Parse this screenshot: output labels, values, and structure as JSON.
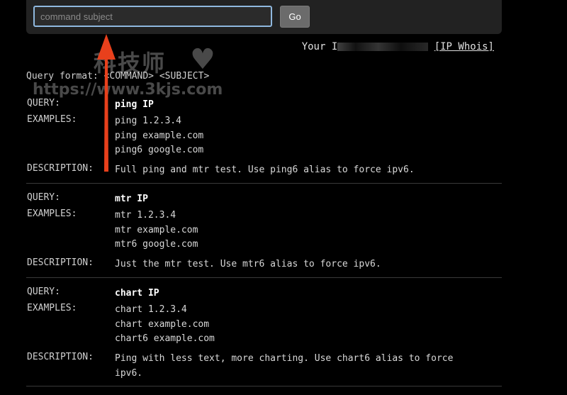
{
  "search": {
    "placeholder": "command subject",
    "go_label": "Go"
  },
  "header": {
    "ip_prefix": "Your I",
    "ip_suffix": "[IP Whois]"
  },
  "query_format": "Query format: <COMMAND> <SUBJECT>",
  "watermark": {
    "chinese": "科技师",
    "url": "https://www.3kjs.com"
  },
  "labels": {
    "query": "QUERY:",
    "examples": "EXAMPLES:",
    "description": "DESCRIPTION:"
  },
  "commands": [
    {
      "query": "ping IP",
      "examples": [
        "ping 1.2.3.4",
        "ping example.com",
        "ping6 google.com"
      ],
      "description": "Full ping and mtr test. Use ping6 alias to force ipv6."
    },
    {
      "query": "mtr IP",
      "examples": [
        "mtr 1.2.3.4",
        "mtr example.com",
        "mtr6 google.com"
      ],
      "description": "Just the mtr test. Use mtr6 alias to force ipv6."
    },
    {
      "query": "chart IP",
      "examples": [
        "chart 1.2.3.4",
        "chart example.com",
        "chart6 example.com"
      ],
      "description": "Ping with less text, more charting. Use chart6 alias to force ipv6."
    }
  ],
  "colors": {
    "background": "#000000",
    "topbar": "#222222",
    "input_border": "#8fb8de",
    "button": "#6b6b6b",
    "arrow": "#e8401c"
  }
}
